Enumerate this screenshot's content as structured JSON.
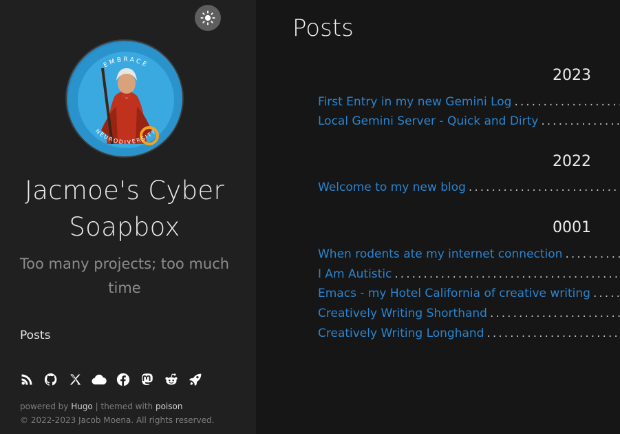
{
  "sidebar": {
    "title": "Jacmoe's Cyber Soapbox",
    "title_line1": "Jacmoe's Cyber",
    "title_line2": "Soapbox",
    "tagline_line1": "Too many projects; too much",
    "tagline_line2": "time",
    "avatar": {
      "top_text": "EMBRACE",
      "bottom_text": "NEURODIVERSITY"
    },
    "nav": [
      {
        "label": "Posts"
      }
    ],
    "social_icons": [
      "rss-icon",
      "github-icon",
      "x-icon",
      "cloud-icon",
      "facebook-icon",
      "mastodon-icon",
      "reddit-icon",
      "rocket-icon"
    ],
    "footer": {
      "powered_by": "powered by",
      "hugo": "Hugo",
      "separator": "|",
      "themed_with": "themed with",
      "poison": "poison",
      "copyright": "© 2022-2023 Jacob Moena. All rights reserved."
    }
  },
  "main": {
    "title": "Posts",
    "groups": [
      {
        "year": "2023",
        "posts": [
          "First Entry in my new Gemini Log",
          "Local Gemini Server - Quick and Dirty"
        ]
      },
      {
        "year": "2022",
        "posts": [
          "Welcome to my new blog"
        ]
      },
      {
        "year": "0001",
        "posts": [
          "When rodents ate my internet connection",
          "I Am Autistic",
          "Emacs - my Hotel California of creative writing",
          "Creatively Writing Shorthand",
          "Creatively Writing Longhand"
        ]
      }
    ]
  },
  "colors": {
    "sidebar_bg": "#202020",
    "main_bg": "#161616",
    "link": "#2b84cf",
    "avatar_blue": "#2a8fc8"
  }
}
